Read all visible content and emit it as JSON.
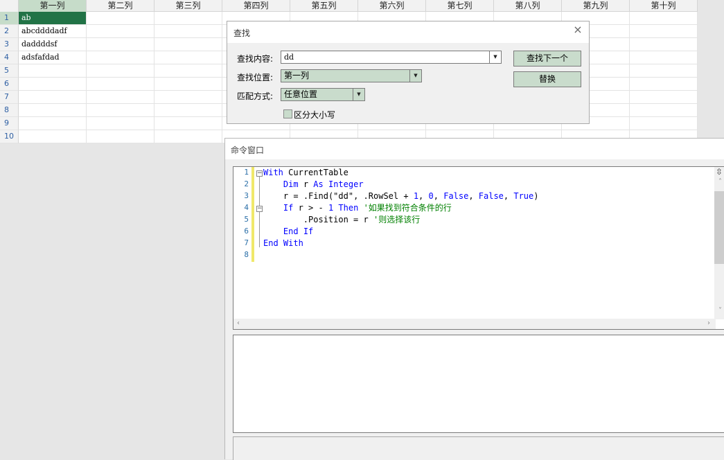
{
  "grid": {
    "columns": [
      "第一列",
      "第二列",
      "第三列",
      "第四列",
      "第五列",
      "第六列",
      "第七列",
      "第八列",
      "第九列",
      "第十列"
    ],
    "rows": [
      "1",
      "2",
      "3",
      "4",
      "5",
      "6",
      "7",
      "8",
      "9",
      "10"
    ],
    "cells": [
      "ab",
      "abcddddadf",
      "daddddsf",
      "adsfafdad"
    ]
  },
  "find_dialog": {
    "title": "查找",
    "close_icon": "×",
    "find_label": "查找内容:",
    "find_value": "dd",
    "location_label": "查找位置:",
    "location_value": "第一列",
    "match_label": "匹配方式:",
    "match_value": "任意位置",
    "case_label": "区分大小写",
    "find_next_label": "查找下一个",
    "replace_label": "替换"
  },
  "command_window": {
    "title": "命令窗口",
    "line_numbers": [
      "1",
      "2",
      "3",
      "4",
      "5",
      "6",
      "7",
      "8"
    ],
    "code_lines": [
      "With CurrentTable",
      "    Dim r As Integer",
      "    r = .Find(\"dd\", .RowSel + 1, 0, False, False, True)",
      "    If r > - 1 Then '如果找到符合条件的行",
      "        .Position = r '则选择该行",
      "    End If",
      "End With",
      ""
    ]
  },
  "colors": {
    "selected_cell": "#217346",
    "selected_header": "#c6dcc9",
    "button_fill": "#c9dccc",
    "keyword": "#0000ff",
    "comment": "#008000"
  }
}
